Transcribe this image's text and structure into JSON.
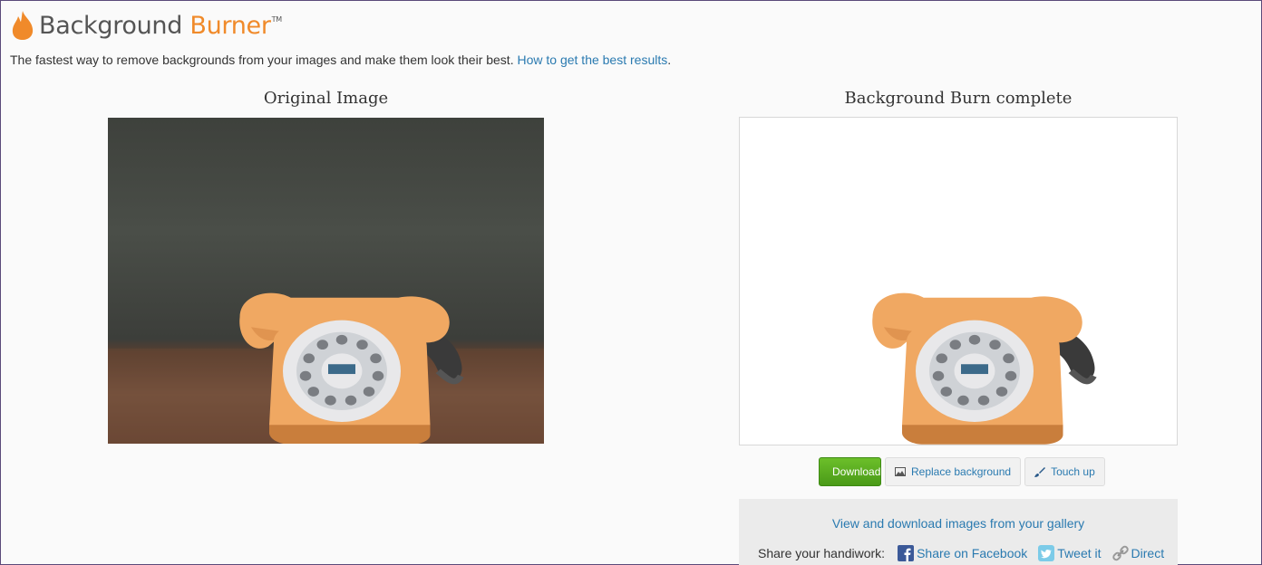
{
  "header": {
    "logo_word1": "Background",
    "logo_word2": "Burner",
    "logo_tm": "TM",
    "tagline": "The fastest way to remove backgrounds from your images and make them look their best.",
    "help_link": "How to get the best results",
    "help_suffix": "."
  },
  "original": {
    "title": "Original Image"
  },
  "result": {
    "title": "Background Burn complete"
  },
  "actions": {
    "download": "Download",
    "replace": "Replace background",
    "touchup": "Touch up"
  },
  "share": {
    "gallery_link": "View and download images from your gallery",
    "label": "Share your handiwork:",
    "facebook": "Share on Facebook",
    "twitter": "Tweet it",
    "direct": "Direct"
  },
  "icons": [
    "flame-icon",
    "save-icon",
    "image-icon",
    "brush-icon",
    "facebook-icon",
    "twitter-icon",
    "link-icon"
  ],
  "colors": {
    "accent": "#f08a2a",
    "link": "#2a7ab0",
    "download": "#5aab20"
  }
}
